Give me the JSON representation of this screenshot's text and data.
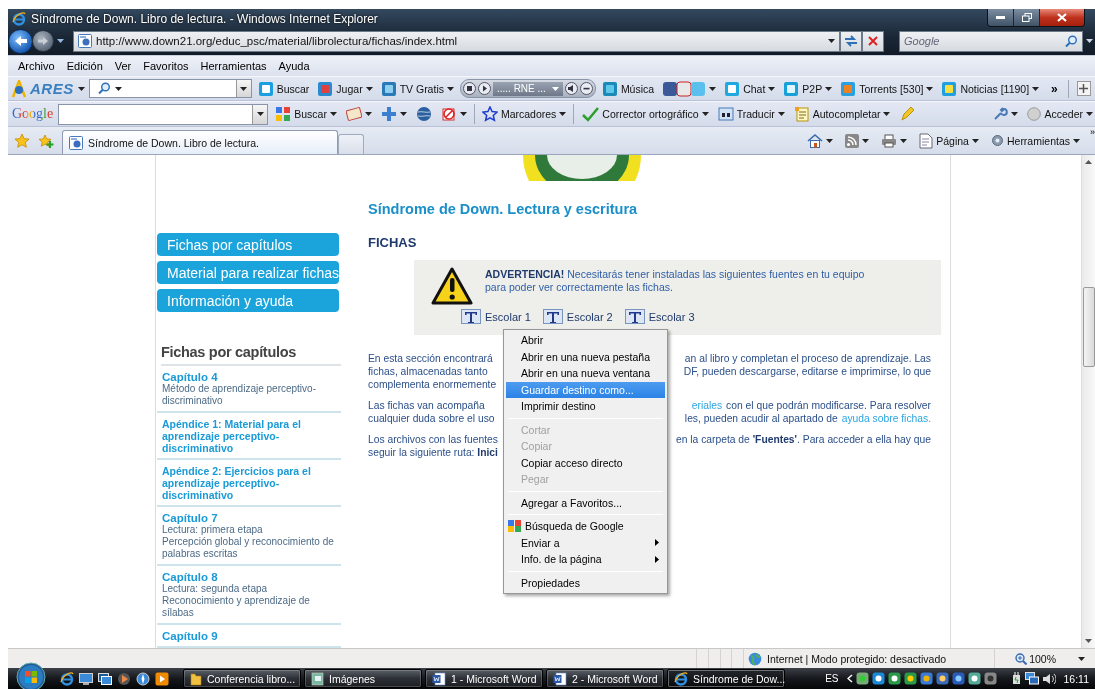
{
  "window": {
    "title": "Síndrome de Down. Libro de lectura. - Windows Internet Explorer"
  },
  "address_bar": {
    "url": "http://www.down21.org/educ_psc/material/librolectura/fichas/index.html"
  },
  "search_box": {
    "placeholder": "Google"
  },
  "menu_bar": [
    {
      "label": "Archivo"
    },
    {
      "label": "Edición"
    },
    {
      "label": "Ver"
    },
    {
      "label": "Favoritos"
    },
    {
      "label": "Herramientas"
    },
    {
      "label": "Ayuda"
    }
  ],
  "ares_toolbar": {
    "logo": "ARES",
    "items": [
      {
        "kind": "button",
        "label": "Buscar",
        "dropdown": false
      },
      {
        "kind": "button",
        "label": "Jugar",
        "dropdown": true
      },
      {
        "kind": "button",
        "label": "TV Gratis",
        "dropdown": true
      },
      {
        "kind": "radio",
        "label": "..... RNE ...",
        "dropdown": true
      },
      {
        "kind": "button",
        "label": "Música",
        "dropdown": false
      },
      {
        "kind": "icons",
        "dropdown": true
      },
      {
        "kind": "button",
        "label": "Chat",
        "dropdown": true
      },
      {
        "kind": "button",
        "label": "P2P",
        "dropdown": true
      },
      {
        "kind": "button",
        "label": "Torrents [530]",
        "dropdown": true
      },
      {
        "kind": "button",
        "label": "Noticias [1190]",
        "dropdown": true
      }
    ],
    "overflow": "»"
  },
  "google_toolbar": {
    "logo": "Google",
    "items": [
      {
        "label": "Buscar",
        "dropdown": true
      },
      {
        "dropdown": true
      },
      {
        "dropdown": true
      },
      {
        "dropdown": false
      },
      {
        "dropdown": true
      },
      {
        "label": "Marcadores",
        "dropdown": true
      },
      {
        "label": "Corrector ortográfico",
        "dropdown": true
      },
      {
        "label": "Traducir",
        "dropdown": true
      },
      {
        "label": "Autocompletar",
        "dropdown": true
      },
      {
        "dropdown": false
      }
    ],
    "right_items": [
      {
        "dropdown": true
      },
      {
        "label": "Acceder",
        "dropdown": true
      }
    ]
  },
  "tab_row": {
    "tabs": [
      {
        "label": "Síndrome de Down. Libro de lectura.",
        "selected": true
      }
    ],
    "commands": [
      {
        "dropdown": true
      },
      {
        "dropdown": true
      },
      {
        "dropdown": true
      },
      {
        "label": "Página",
        "dropdown": true
      },
      {
        "label": "Herramientas",
        "dropdown": true
      }
    ],
    "overflow": "»"
  },
  "page": {
    "title": "Síndrome de Down. Lectura y escritura",
    "nav_buttons": [
      {
        "label": "Fichas por capítulos"
      },
      {
        "label": "Material para realizar fichas"
      },
      {
        "label": "Información y ayuda"
      }
    ],
    "chapters_heading": "Fichas por capítulos",
    "chapters": [
      {
        "kind": "chapter",
        "title": "Capítulo 4",
        "lines": [
          "Método de aprendizaje perceptivo-discriminativo"
        ]
      },
      {
        "kind": "appendix",
        "title": "Apéndice 1: Material para el aprendizaje perceptivo-discriminativo"
      },
      {
        "kind": "appendix",
        "title": "Apéndice 2: Ejercicios para el aprendizaje perceptivo-discriminativo"
      },
      {
        "kind": "chapter",
        "title": "Capítulo 7",
        "lines": [
          "Lectura: primera etapa",
          "Percepción global y reconocimiento de palabras escritas"
        ]
      },
      {
        "kind": "chapter",
        "title": "Capítulo 8",
        "lines": [
          "Lectura: segunda etapa",
          "Reconocimiento y aprendizaje de sílabas"
        ]
      },
      {
        "kind": "chapter",
        "title": "Capítulo 9"
      }
    ],
    "section_heading": "FICHAS",
    "warning": {
      "text": "**ADVERTENCIA!** Necesitarás tener instaladas las siguientes fuentes en tu equipo para poder ver correctamente las fichas.",
      "fonts": [
        "Escolar 1",
        "Escolar 2",
        "Escolar 3"
      ]
    },
    "paragraphs": [
      {
        "lines": [
          {
            "left": "En esta sección encontrará",
            "right": [
              {
                "kind": "text",
                "text": "an al libro y completan el proceso de aprendizaje. Las"
              }
            ]
          },
          {
            "left": "fichas, almacenadas tanto",
            "right": [
              {
                "kind": "text",
                "text": "DF, pueden descargarse, editarse e imprimirse, lo que"
              }
            ]
          },
          {
            "left": "complementa enormemente"
          }
        ]
      },
      {
        "lines": [
          {
            "left": "Las fichas van acompaña",
            "right": [
              {
                "kind": "link",
                "text": "eriales"
              },
              {
                "kind": "text",
                "text": "con el que podrán modificarse. Para resolver"
              }
            ]
          },
          {
            "left": "cualquier duda sobre el uso",
            "right": [
              {
                "kind": "text",
                "text": "les, pueden acudir al apartado de"
              },
              {
                "kind": "link",
                "text": "ayuda sobre fichas."
              }
            ]
          }
        ]
      },
      {
        "lines": [
          {
            "left": "Los archivos con las fuentes",
            "right": [
              {
                "kind": "text",
                "text": "en la carpeta de **'Fuentes'**. Para acceder a ella hay que"
              }
            ]
          },
          {
            "left": "seguir la siguiente ruta: **Inici**"
          }
        ]
      }
    ]
  },
  "context_menu": [
    {
      "kind": "item",
      "label": "Abrir",
      "selected": false,
      "disabled": false,
      "submenu": false
    },
    {
      "kind": "item",
      "label": "Abrir en una nueva pestaña",
      "selected": false,
      "disabled": false,
      "submenu": false
    },
    {
      "kind": "item",
      "label": "Abrir en una nueva ventana",
      "selected": false,
      "disabled": false,
      "submenu": false
    },
    {
      "kind": "item",
      "label": "Guardar destino como...",
      "selected": true,
      "disabled": false,
      "submenu": false
    },
    {
      "kind": "item",
      "label": "Imprimir destino",
      "selected": false,
      "disabled": false,
      "submenu": false
    },
    {
      "kind": "separator"
    },
    {
      "kind": "item",
      "label": "Cortar",
      "selected": false,
      "disabled": true,
      "submenu": false
    },
    {
      "kind": "item",
      "label": "Copiar",
      "selected": false,
      "disabled": true,
      "submenu": false
    },
    {
      "kind": "item",
      "label": "Copiar acceso directo",
      "selected": false,
      "disabled": false,
      "submenu": false
    },
    {
      "kind": "item",
      "label": "Pegar",
      "selected": false,
      "disabled": true,
      "submenu": false
    },
    {
      "kind": "separator"
    },
    {
      "kind": "item",
      "label": "Agregar a Favoritos...",
      "selected": false,
      "disabled": false,
      "submenu": false
    },
    {
      "kind": "separator"
    },
    {
      "kind": "icon_item",
      "label": "Búsqueda de Google",
      "selected": false,
      "disabled": false,
      "submenu": false
    },
    {
      "kind": "item",
      "label": "Enviar a",
      "selected": false,
      "disabled": false,
      "submenu": true
    },
    {
      "kind": "item",
      "label": "Info. de la página",
      "selected": false,
      "disabled": false,
      "submenu": true
    },
    {
      "kind": "separator"
    },
    {
      "kind": "item",
      "label": "Propiedades",
      "selected": false,
      "disabled": false,
      "submenu": false
    }
  ],
  "status_bar": {
    "zone": "Internet | Modo protegido: desactivado",
    "zoom": "100%"
  },
  "taskbar": {
    "tasks": [
      {
        "label": "Conferencia  libro...",
        "selected": false
      },
      {
        "label": "Imágenes",
        "selected": false
      },
      {
        "label": "1 - Microsoft Word",
        "selected": false
      },
      {
        "label": "2 - Microsoft Word",
        "selected": false
      },
      {
        "label": "Síndrome de Dow...",
        "selected": true
      }
    ],
    "language": "ES",
    "clock": "16:11"
  }
}
